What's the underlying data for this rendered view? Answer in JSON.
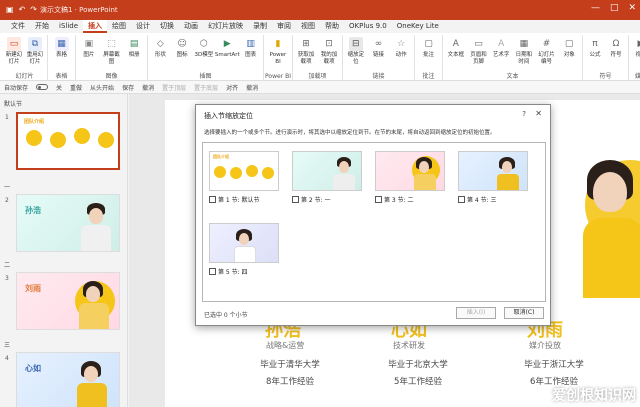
{
  "titlebar": {
    "autosave_label": "自动保存",
    "doc_title": "演示文稿1 · PowerPoint",
    "window_controls": [
      "—",
      "□",
      "✕"
    ]
  },
  "menu": {
    "tabs": [
      "文件",
      "开始",
      "iSlide",
      "插入",
      "绘图",
      "设计",
      "切换",
      "动画",
      "幻灯片放映",
      "录制",
      "审阅",
      "视图",
      "帮助",
      "OKPlus 9.0",
      "OneKey Lite"
    ],
    "active": "插入"
  },
  "ribbon": {
    "groups": [
      {
        "name": "幻灯片",
        "buttons": [
          "新建幻灯片",
          "重用幻灯片"
        ]
      },
      {
        "name": "表格",
        "buttons": [
          "表格"
        ]
      },
      {
        "name": "图像",
        "buttons": [
          "图片",
          "屏幕截图",
          "相册"
        ]
      },
      {
        "name": "插图",
        "buttons": [
          "形状",
          "图标",
          "3D模型",
          "SmartArt",
          "图表"
        ]
      },
      {
        "name": "Power BI",
        "buttons": [
          "Power BI"
        ]
      },
      {
        "name": "加载项",
        "buttons": [
          "获取加载项",
          "我的加载项"
        ]
      },
      {
        "name": "链接",
        "buttons": [
          "缩放定位",
          "链接",
          "动作"
        ]
      },
      {
        "name": "批注",
        "buttons": [
          "批注"
        ]
      },
      {
        "name": "文本",
        "buttons": [
          "文本框",
          "页眉和页脚",
          "艺术字",
          "日期和时间",
          "幻灯片编号",
          "对象"
        ]
      },
      {
        "name": "符号",
        "buttons": [
          "公式",
          "符号"
        ]
      },
      {
        "name": "媒体",
        "buttons": [
          "视频"
        ]
      }
    ]
  },
  "quicktoolbar": {
    "items": [
      "自动保存",
      "关",
      "重做",
      "从头开始",
      "保存",
      "撤消",
      "置于顶层",
      "置于底层",
      "对齐",
      "撤消"
    ]
  },
  "slidepanel": {
    "sections": [
      {
        "label": "默认节",
        "slide": "1"
      },
      {
        "label": "一",
        "slide": "2"
      },
      {
        "label": "二",
        "slide": "3"
      },
      {
        "label": "三",
        "slide": "4"
      }
    ],
    "thumb_titles": [
      "团队介绍",
      "孙浩",
      "刘雨",
      "心如"
    ]
  },
  "slide": {
    "people": [
      {
        "name": "孙浩",
        "role": "战略&运营",
        "line1": "毕业于清华大学",
        "line2": "8年工作经验"
      },
      {
        "name": "心如",
        "role": "技术研发",
        "line1": "毕业于北京大学",
        "line2": "5年工作经验"
      },
      {
        "name": "刘雨",
        "role": "媒介投放",
        "line1": "毕业于浙江大学",
        "line2": "6年工作经验"
      }
    ]
  },
  "dialog": {
    "title": "插入节缩放定位",
    "help": "?",
    "close": "✕",
    "description": "选择要插入的一个或多个节。进行演示时，将其选中以缩放定位到节。在节的末尾，将自动返回到缩放定位的初始位置。",
    "sections": [
      {
        "label": "第 1 节: 默认节"
      },
      {
        "label": "第 2 节: 一"
      },
      {
        "label": "第 3 节: 二"
      },
      {
        "label": "第 4 节: 三"
      },
      {
        "label": "第 5 节: 四"
      }
    ],
    "count_text": "已选中 0 个小节",
    "insert_label": "插入(I)",
    "cancel_label": "取消(C)"
  },
  "watermark": "爱创根知识网",
  "colors": {
    "brand": "#c43e1c",
    "accent_yellow": "#f0c020"
  }
}
